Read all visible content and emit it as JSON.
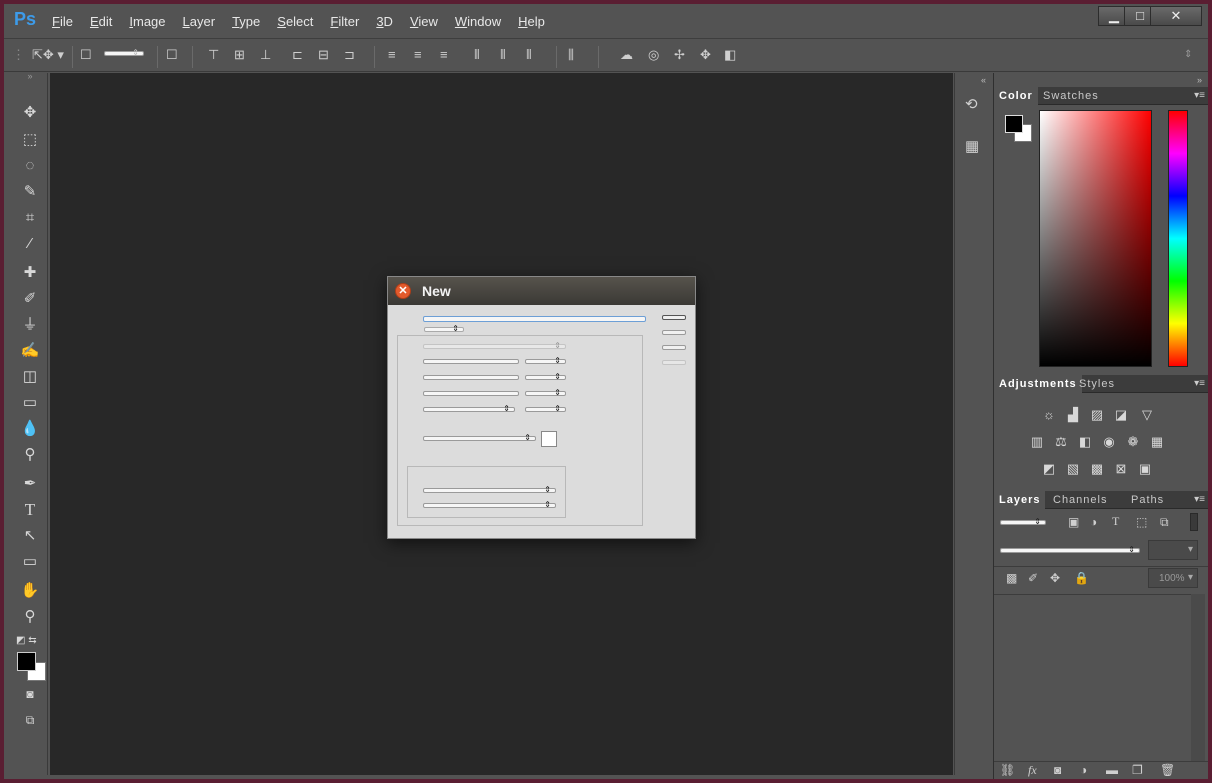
{
  "app": {
    "logo": "Ps"
  },
  "menu": [
    "File",
    "Edit",
    "Image",
    "Layer",
    "Type",
    "Select",
    "Filter",
    "3D",
    "View",
    "Window",
    "Help"
  ],
  "window_controls": {
    "minimize": "▁",
    "maximize": "□",
    "close": "✕"
  },
  "panels": {
    "color_tabs": [
      "Color",
      "Swatches"
    ],
    "adjustments_tabs": [
      "Adjustments",
      "Styles"
    ],
    "layers_tabs": [
      "Layers",
      "Channels",
      "Paths"
    ],
    "layers_opacity": "100%"
  },
  "dialog": {
    "title": "New",
    "close_glyph": "✕"
  },
  "colors": {
    "background": "#535353",
    "canvas": "#282828",
    "accent": "#3d9be9",
    "dialog_close": "#e25a2c"
  }
}
